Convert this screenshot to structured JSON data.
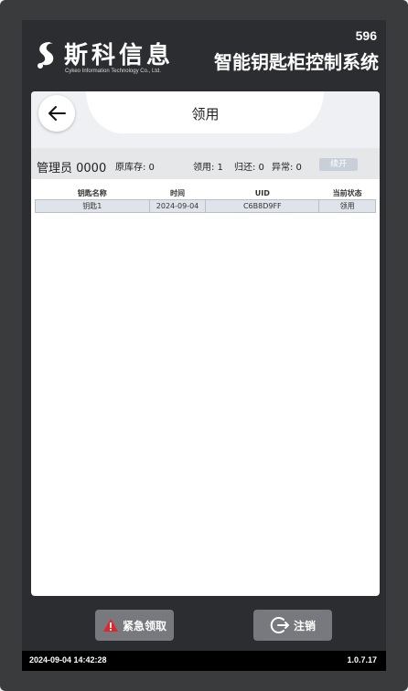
{
  "brand": {
    "name_cn": "斯科信息",
    "name_en": "Cykeo Information Technology Co., Ltd."
  },
  "device": {
    "number": "596",
    "system_title": "智能钥匙柜控制系统"
  },
  "page": {
    "title": "领用",
    "back_icon": "arrow-left-icon"
  },
  "info": {
    "admin": "管理员 0000",
    "stock": "原库存: 0",
    "borrowed": "领用: 1",
    "returned": "归还: 0",
    "abnormal": "异常: 0",
    "renew_label": "续开"
  },
  "table": {
    "headers": [
      "钥匙名称",
      "时间",
      "UID",
      "当前状态"
    ],
    "rows": [
      [
        "钥匙1",
        "2024-09-04",
        "C6B8D9FF",
        "领用"
      ]
    ]
  },
  "buttons": {
    "emergency": "紧急领取",
    "logout": "注销"
  },
  "status": {
    "datetime": "2024-09-04 14:42:28",
    "version": "1.0.7.17"
  },
  "colors": {
    "bezel": "#3a3b3d",
    "header_bg": "#2b2d31",
    "button_bg": "#77797e",
    "warning": "#e0262c",
    "renew_btn": "#c9cfd9"
  }
}
